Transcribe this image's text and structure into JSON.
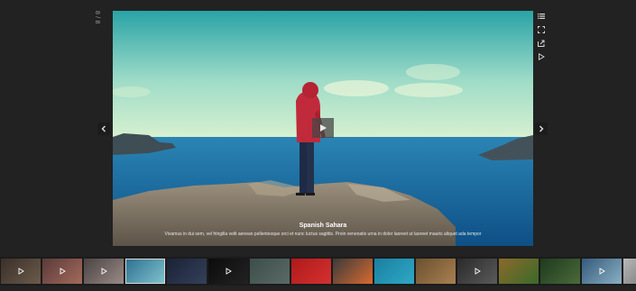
{
  "gallery": {
    "counter": "8 / 8",
    "slide": {
      "title": "Spanish Sahara",
      "description": "Vivamus in dui sem, vel fringilla velit aenean pellentesque orci et nunc luctus sagittis. Proin venenatis urna in dolor laoreet ut laoreet mauris aliquet ada tempor"
    },
    "toolbar": [
      {
        "name": "thumbnails-toggle",
        "icon": "list-icon"
      },
      {
        "name": "fullscreen-toggle",
        "icon": "fullscreen-icon"
      },
      {
        "name": "share-button",
        "icon": "share-icon"
      },
      {
        "name": "autoplay-button",
        "icon": "play-icon"
      }
    ],
    "nav": {
      "prev_icon": "chevron-left-icon",
      "next_icon": "chevron-right-icon"
    },
    "thumbnails": [
      {
        "color_a": "#3a2f2a",
        "color_b": "#6b5b4a",
        "video": true
      },
      {
        "color_a": "#5a3a3a",
        "color_b": "#a36a5a",
        "video": true
      },
      {
        "color_a": "#4a4444",
        "color_b": "#9a8a86",
        "video": true
      },
      {
        "color_a": "#2f6f8f",
        "color_b": "#7fc4cf",
        "video": false,
        "active": true
      },
      {
        "color_a": "#1a2235",
        "color_b": "#34405a",
        "video": false
      },
      {
        "color_a": "#0c0c0c",
        "color_b": "#222222",
        "video": true
      },
      {
        "color_a": "#3d4e4a",
        "color_b": "#5a6a66",
        "video": false
      },
      {
        "color_a": "#b01a1a",
        "color_b": "#d43030",
        "video": false
      },
      {
        "color_a": "#3a3a3a",
        "color_b": "#d86a30",
        "video": false
      },
      {
        "color_a": "#1a7fa0",
        "color_b": "#2fa8c6",
        "video": false
      },
      {
        "color_a": "#6a5030",
        "color_b": "#a98050",
        "video": false
      },
      {
        "color_a": "#2a2a2a",
        "color_b": "#5a5a5a",
        "video": true
      },
      {
        "color_a": "#8a6a2a",
        "color_b": "#3a6a2a",
        "video": false
      },
      {
        "color_a": "#1e3a1e",
        "color_b": "#4a6a3a",
        "video": false
      },
      {
        "color_a": "#355a7a",
        "color_b": "#8ab0c4",
        "video": true
      },
      {
        "color_a": "#b8b8b8",
        "color_b": "#8a8a8a",
        "video": false
      },
      {
        "color_a": "#1e2a2a",
        "color_b": "#2e3e3e",
        "video": false
      }
    ]
  }
}
